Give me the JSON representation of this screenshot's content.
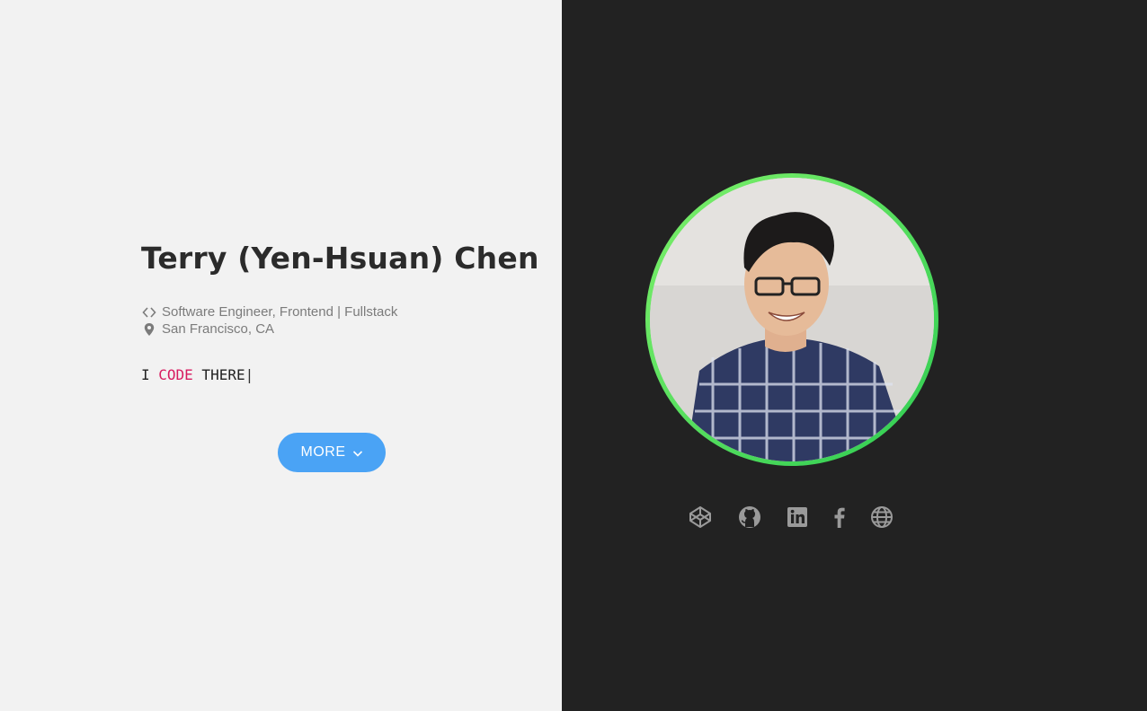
{
  "profile": {
    "name": "Terry (Yen-Hsuan) Chen",
    "role": "Software Engineer, Frontend | Fullstack",
    "location": "San Francisco, CA",
    "avatar_alt": "profile photo"
  },
  "typed": {
    "prefix": "I ",
    "accent": "CODE",
    "suffix": " THERE",
    "cursor": "|"
  },
  "more_button": {
    "label": "MORE"
  },
  "social": [
    {
      "icon": "codepen-icon",
      "label": "CodePen"
    },
    {
      "icon": "github-icon",
      "label": "GitHub"
    },
    {
      "icon": "linkedin-icon",
      "label": "LinkedIn"
    },
    {
      "icon": "facebook-icon",
      "label": "Facebook"
    },
    {
      "icon": "globe-icon",
      "label": "Website"
    }
  ],
  "colors": {
    "left_bg": "#f2f2f2",
    "right_bg": "#222222",
    "accent": "#d81b60",
    "button": "#4aa3f5",
    "ring": "#4cd964"
  }
}
